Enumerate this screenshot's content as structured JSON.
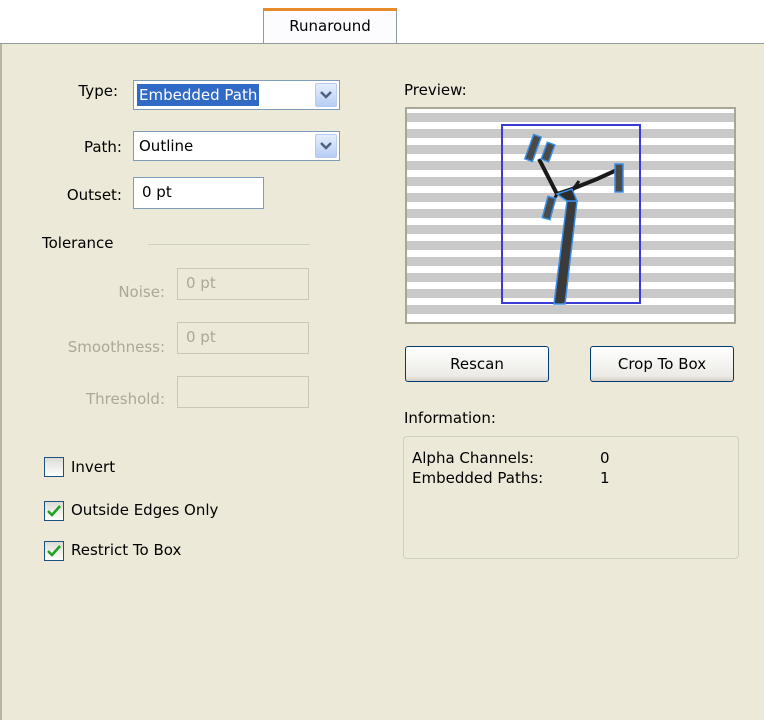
{
  "tab": {
    "label": "Runaround"
  },
  "type": {
    "label": "Type:",
    "value": "Embedded Path"
  },
  "path": {
    "label": "Path:",
    "value": "Outline"
  },
  "outset": {
    "label": "Outset:",
    "value": "0 pt"
  },
  "tolerance": {
    "title": "Tolerance",
    "noise_label": "Noise:",
    "noise_value": "0 pt",
    "smoothness_label": "Smoothness:",
    "smoothness_value": "0 pt",
    "threshold_label": "Threshold:",
    "threshold_value": ""
  },
  "checkboxes": {
    "invert": {
      "label": "Invert",
      "checked": false
    },
    "outside_edges_only": {
      "label": "Outside Edges Only",
      "checked": true
    },
    "restrict_to_box": {
      "label": "Restrict To Box",
      "checked": true
    }
  },
  "preview": {
    "label": "Preview:"
  },
  "buttons": {
    "rescan": "Rescan",
    "crop_to_box": "Crop To Box"
  },
  "information": {
    "label": "Information:",
    "rows": [
      {
        "name": "Alpha Channels:",
        "value": "0"
      },
      {
        "name": "Embedded Paths:",
        "value": "1"
      }
    ]
  },
  "colors": {
    "accent": "#e68b2c",
    "selection": "#316ac5",
    "bounding_box": "#3a3ad6",
    "path": "#3a8fe8"
  },
  "icons": {
    "dropdown": "chevron-down-icon",
    "check": "checkmark-icon"
  }
}
